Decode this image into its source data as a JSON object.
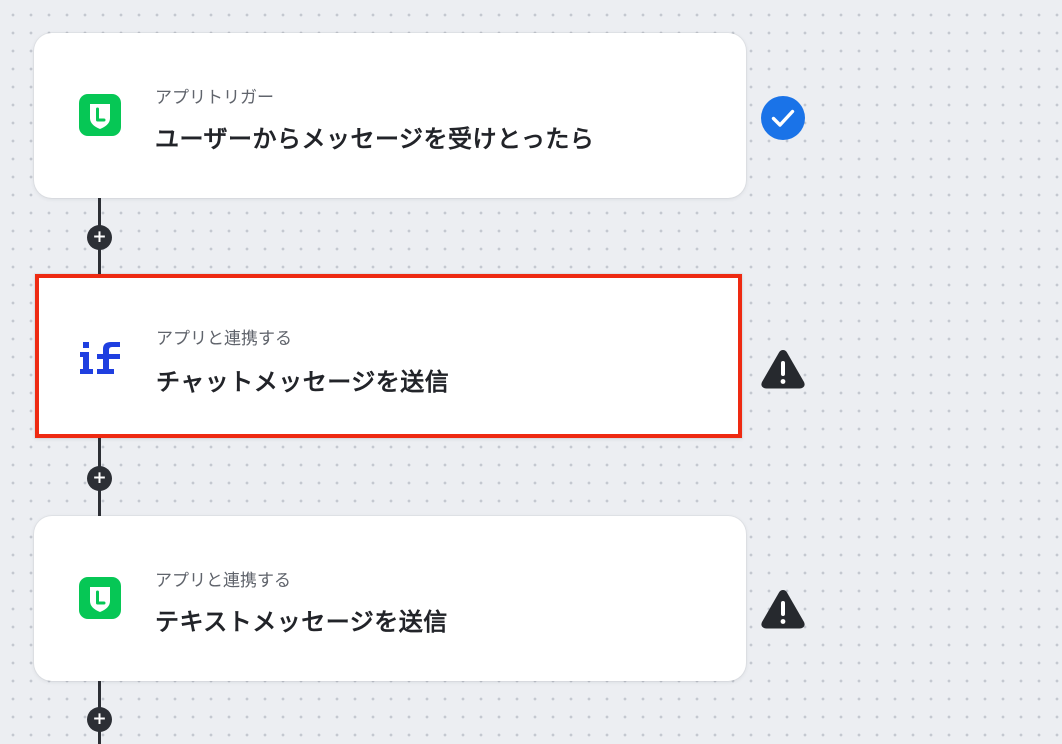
{
  "flow": {
    "steps": [
      {
        "caption": "アプリトリガー",
        "title": "ユーザーからメッセージを受けとったら",
        "app_icon": "line-icon",
        "status": "success-check-icon"
      },
      {
        "caption": "アプリと連携する",
        "title": "チャットメッセージを送信",
        "app_icon": "if-logo-icon",
        "status": "warning-icon"
      },
      {
        "caption": "アプリと連携する",
        "title": "テキストメッセージを送信",
        "app_icon": "line-icon",
        "status": "warning-icon"
      }
    ],
    "add_button_label": "+"
  },
  "colors": {
    "canvas": "#eceef2",
    "line_green": "#06c755",
    "if_blue": "#1f3fe0",
    "check_blue": "#1a73e8",
    "highlight_red": "#ee2a12",
    "connector": "#2c2f35"
  }
}
